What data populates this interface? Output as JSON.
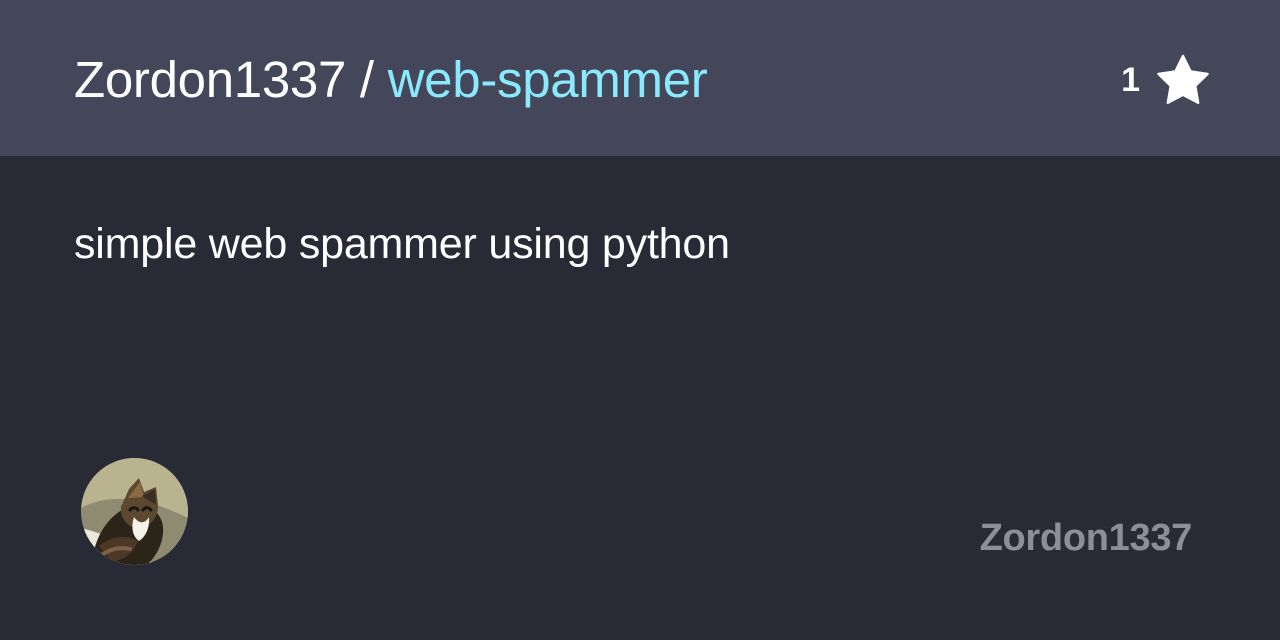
{
  "header": {
    "owner": "Zordon1337",
    "separator": " / ",
    "repo": "web-spammer",
    "star_count": "1",
    "star_icon": "star-icon"
  },
  "main": {
    "description": "simple web spammer using python"
  },
  "footer": {
    "avatar_icon": "avatar",
    "username": "Zordon1337"
  },
  "colors": {
    "background": "#282a36",
    "header_background": "#44475a",
    "repo_accent": "#8be9fd",
    "muted_text": "#8d8e96",
    "text": "#ffffff"
  }
}
